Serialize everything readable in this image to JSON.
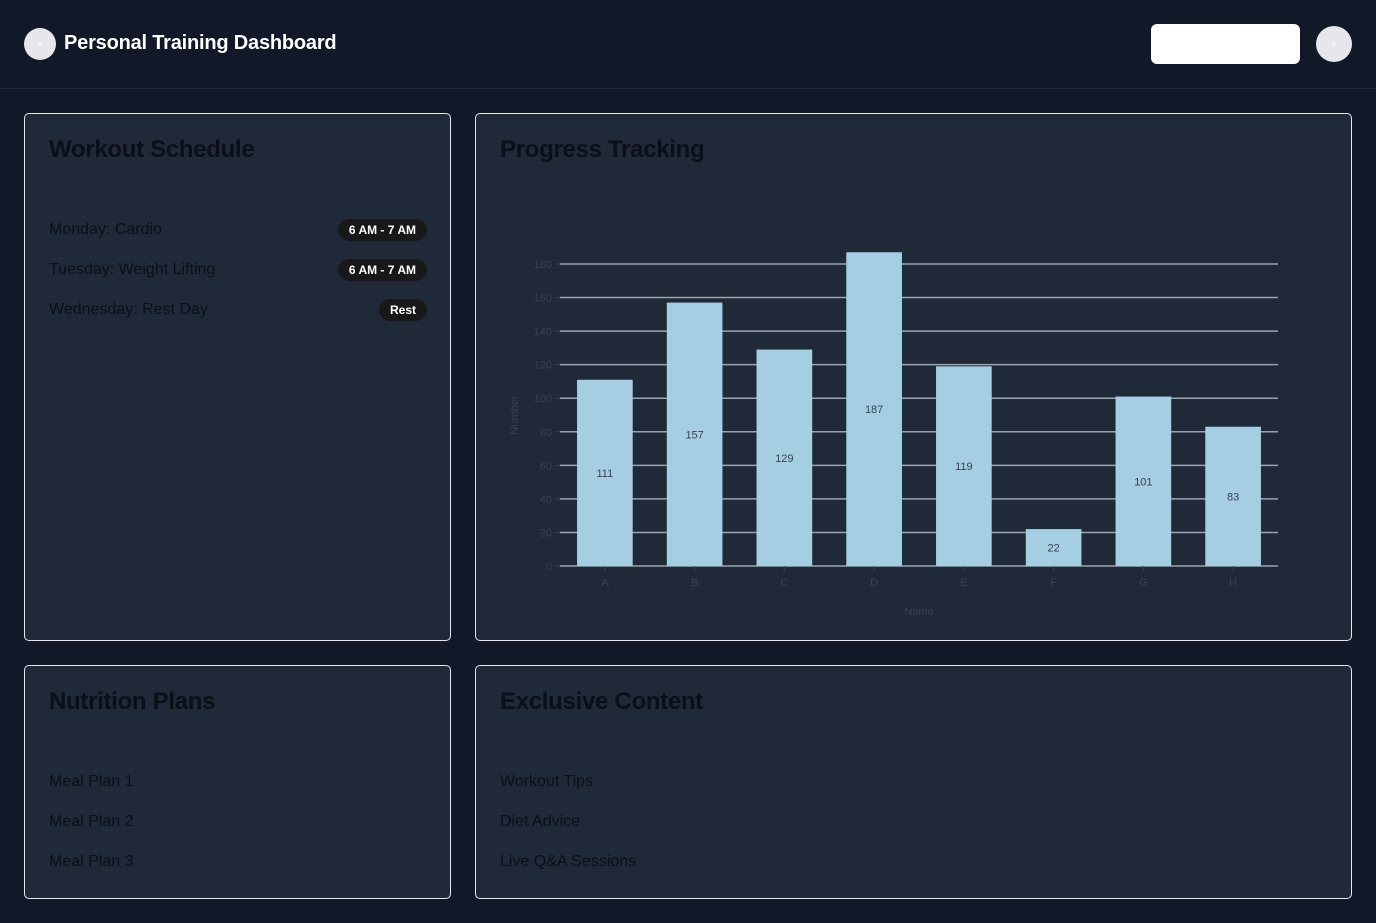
{
  "header": {
    "title": "Personal Training Dashboard",
    "search_placeholder": "",
    "logo_icon": "logo-icon",
    "avatar_icon": "user-avatar-icon"
  },
  "workout": {
    "title": "Workout Schedule",
    "items": [
      {
        "label": "Monday: Cardio",
        "badge": "6 AM - 7 AM"
      },
      {
        "label": "Tuesday: Weight Lifting",
        "badge": "6 AM - 7 AM"
      },
      {
        "label": "Wednesday: Rest Day",
        "badge": "Rest"
      }
    ]
  },
  "progress": {
    "title": "Progress Tracking"
  },
  "nutrition": {
    "title": "Nutrition Plans",
    "items": [
      "Meal Plan 1",
      "Meal Plan 2",
      "Meal Plan 3"
    ]
  },
  "exclusive": {
    "title": "Exclusive Content",
    "items": [
      "Workout Tips",
      "Diet Advice",
      "Live Q&A Sessions"
    ]
  },
  "colors": {
    "background": "#111827",
    "card": "#1f2937",
    "card_border": "#e5e7eb",
    "bar": "#a6cee3",
    "badge": "#18181b"
  },
  "chart_data": {
    "type": "bar",
    "categories": [
      "A",
      "B",
      "C",
      "D",
      "E",
      "F",
      "G",
      "H"
    ],
    "values": [
      111,
      157,
      129,
      187,
      119,
      22,
      101,
      83
    ],
    "xlabel": "Name",
    "ylabel": "Number",
    "ylim": [
      0,
      180
    ],
    "yticks": [
      0,
      20,
      40,
      60,
      80,
      100,
      120,
      140,
      160,
      180
    ],
    "grid": true,
    "data_labels": true
  }
}
